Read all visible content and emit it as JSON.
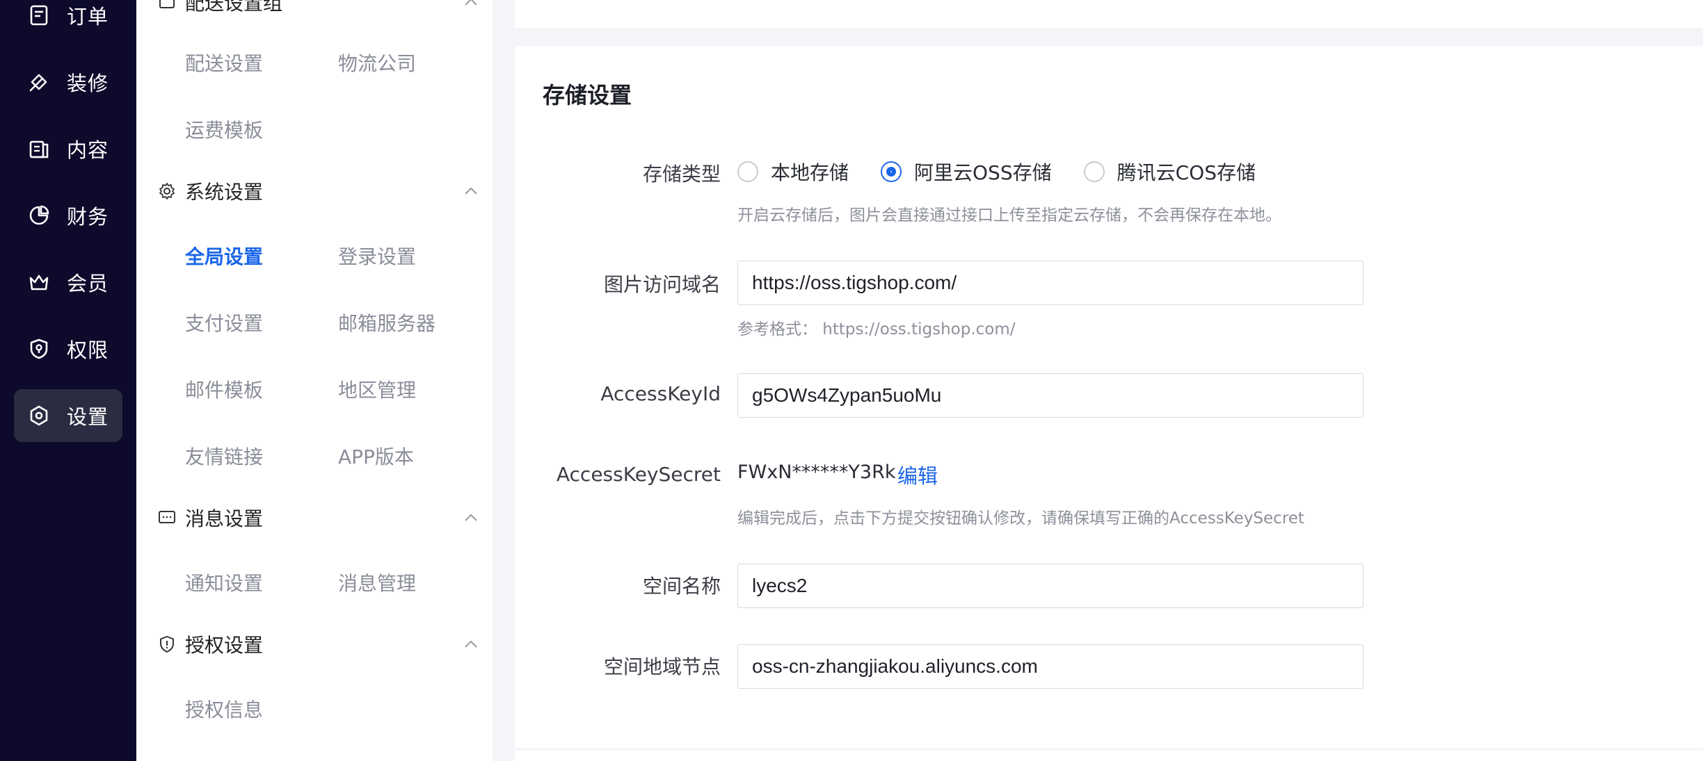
{
  "rail": {
    "items": [
      {
        "label": "订单",
        "icon": "order-icon"
      },
      {
        "label": "装修",
        "icon": "decorate-icon"
      },
      {
        "label": "内容",
        "icon": "content-icon"
      },
      {
        "label": "财务",
        "icon": "finance-icon"
      },
      {
        "label": "会员",
        "icon": "member-icon"
      },
      {
        "label": "权限",
        "icon": "permission-icon"
      },
      {
        "label": "设置",
        "icon": "settings-icon",
        "active": true
      }
    ]
  },
  "submenu": {
    "top_partial_group": "配送设置组",
    "delivery": {
      "links": [
        "配送设置",
        "物流公司",
        "运费模板"
      ]
    },
    "system": {
      "title": "系统设置",
      "links": [
        "全局设置",
        "登录设置",
        "支付设置",
        "邮箱服务器",
        "邮件模板",
        "地区管理",
        "友情链接",
        "APP版本"
      ],
      "active": "全局设置"
    },
    "message": {
      "title": "消息设置",
      "links": [
        "通知设置",
        "消息管理"
      ]
    },
    "auth": {
      "title": "授权设置",
      "links": [
        "授权信息"
      ]
    }
  },
  "storage": {
    "title": "存储设置",
    "type_label": "存储类型",
    "options": [
      "本地存储",
      "阿里云OSS存储",
      "腾讯云COS存储"
    ],
    "selected": "阿里云OSS存储",
    "type_hint": "开启云存储后，图片会直接通过接口上传至指定云存储，不会再保存在本地。",
    "domain_label": "图片访问域名",
    "domain_value": "https://oss.tigshop.com/",
    "domain_hint": "参考格式： https://oss.tigshop.com/",
    "keyid_label": "AccessKeyId",
    "keyid_value": "g5OWs4Zypan5uoMu",
    "secret_label": "AccessKeySecret",
    "secret_value": "FWxN******Y3Rk",
    "secret_edit": "编辑",
    "secret_hint": "编辑完成后，点击下方提交按钮确认修改，请确保填写正确的AccessKeySecret",
    "bucket_label": "空间名称",
    "bucket_value": "lyecs2",
    "endpoint_label": "空间地域节点",
    "endpoint_value": "oss-cn-zhangjiakou.aliyuncs.com"
  },
  "colors": {
    "rail_bg": "#0d0a2b",
    "accent": "#1a66e8"
  }
}
